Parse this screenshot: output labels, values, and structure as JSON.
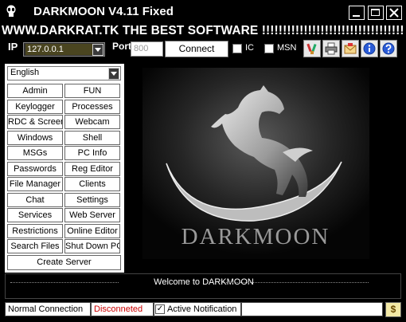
{
  "window": {
    "title": "DARKMOON V4.11 Fixed",
    "icons": {
      "app": "alien-icon",
      "minimize": "minimize-icon",
      "maximize": "maximize-icon",
      "close": "close-icon"
    }
  },
  "banner": {
    "text": "WWW.DARKRAT.TK THE BEST SOFTWARE !!!!!!!!!!!!!!!!!!!!!!!!!!!!!!!!!!!!!!!!!!!!!!!!!!"
  },
  "connection": {
    "ip_label": "IP",
    "ip_value": "127.0.0.1",
    "port_label": "Port",
    "port_value": "800",
    "connect_label": "Connect",
    "ic_label": "IC",
    "ic_checked": false,
    "msn_label": "MSN",
    "msn_checked": false
  },
  "toolbar": {
    "icons": [
      "brush-icon",
      "printer-icon",
      "mail-icon",
      "info-icon",
      "help-icon"
    ]
  },
  "language": {
    "selected": "English"
  },
  "functions": {
    "buttons": [
      "Admin",
      "FUN",
      "Keylogger",
      "Processes",
      "RDC & Screen",
      "Webcam",
      "Windows",
      "Shell",
      "MSGs",
      "PC Info",
      "Passwords",
      "Reg Editor",
      "File Manager",
      "Clients",
      "Chat",
      "Settings",
      "Services",
      "Web Server",
      "Restrictions",
      "Online Editor",
      "Search Files",
      "Shut Down PC"
    ],
    "create_server": "Create Server"
  },
  "logo": {
    "text": "DARKMOON"
  },
  "log": {
    "message": "Welcome to DARKMOON"
  },
  "status": {
    "connection_type": "Normal Connection",
    "state": "Disconneted",
    "state_color": "#cc0000",
    "notification_label": "Active Notification",
    "notification_checked": true,
    "dollar_label": "$"
  }
}
